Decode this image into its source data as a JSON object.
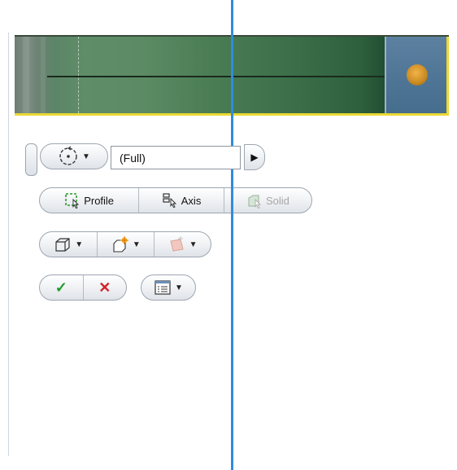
{
  "panel": {
    "extent_selector": {
      "icon": "revolve-extent-icon",
      "value": "(Full)",
      "arrow": "play-right-icon"
    },
    "inputs": {
      "profile": {
        "label": "Profile",
        "icon": "profile-select-icon"
      },
      "axis": {
        "label": "Axis",
        "icon": "axis-select-icon"
      },
      "solid": {
        "label": "Solid",
        "icon": "solid-select-icon",
        "enabled": false
      }
    },
    "output_row": [
      {
        "icon": "solid-output-icon"
      },
      {
        "icon": "new-solid-icon"
      },
      {
        "icon": "surface-output-icon",
        "enabled": false
      }
    ],
    "actions": {
      "ok_icon": "✓",
      "cancel_icon": "✕",
      "options_icon": "list-options-icon"
    }
  },
  "colors": {
    "axis_line": "#2f8de0",
    "model_green": "#4b7d55",
    "selection_yellow": "#ecd834",
    "end_face": "#456d8e"
  }
}
